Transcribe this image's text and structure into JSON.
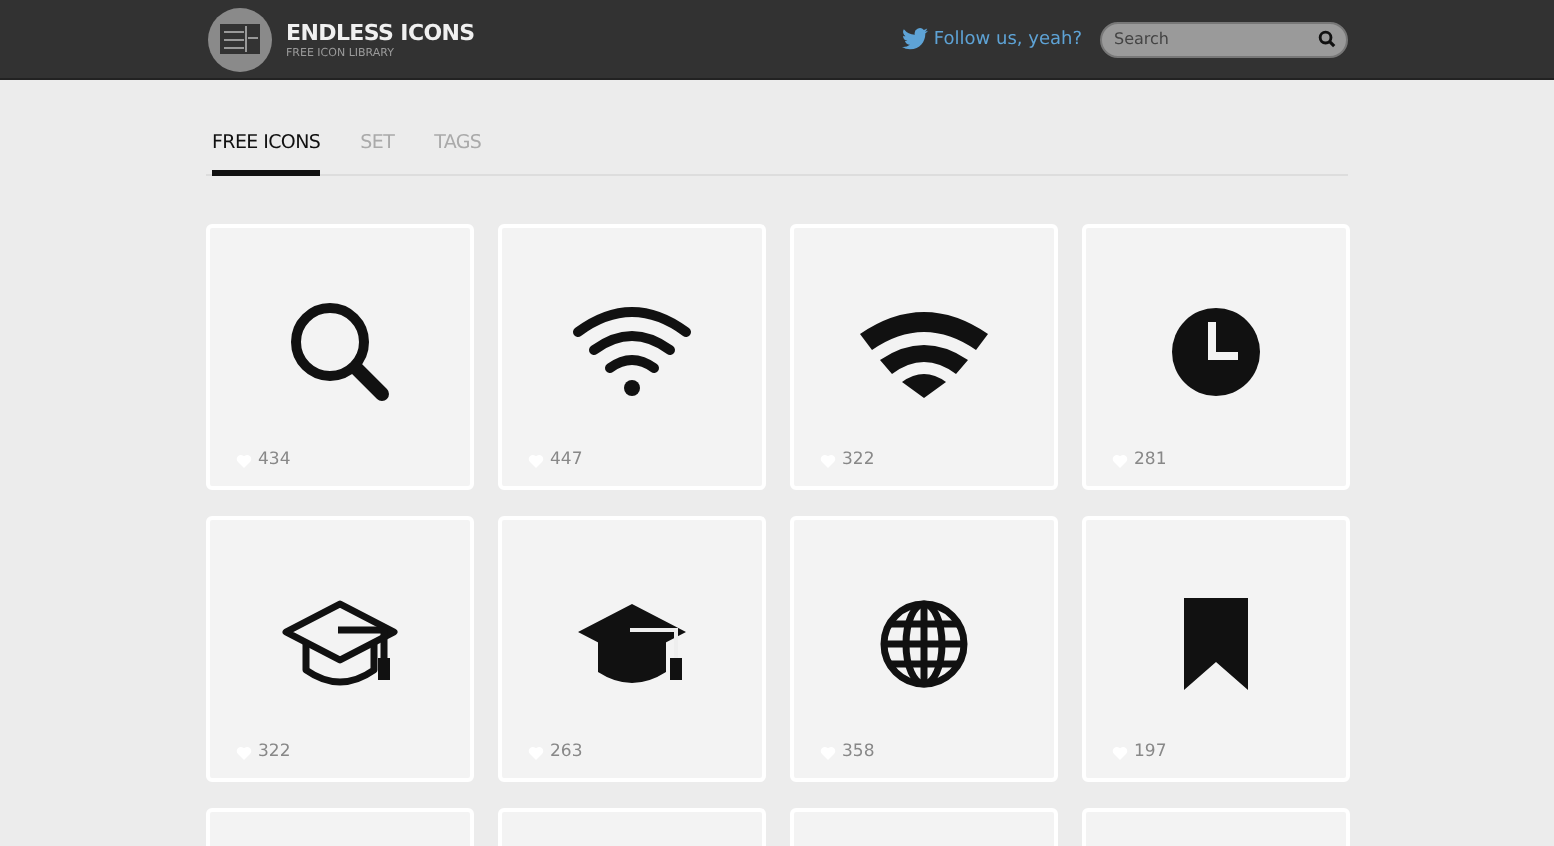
{
  "header": {
    "title": "ENDLESS ICONS",
    "subtitle": "FREE ICON LIBRARY",
    "follow": "Follow us, yeah?",
    "search": {
      "placeholder": "Search"
    }
  },
  "tabs": [
    {
      "label": "FREE ICONS",
      "selected": true
    },
    {
      "label": "SET",
      "selected": false
    },
    {
      "label": "TAGS",
      "selected": false
    }
  ],
  "icons": [
    {
      "kind": "search",
      "likes": "434"
    },
    {
      "kind": "wifi",
      "likes": "447"
    },
    {
      "kind": "wifi-fan",
      "likes": "322"
    },
    {
      "kind": "clock",
      "likes": "281"
    },
    {
      "kind": "cap-outline",
      "likes": "322"
    },
    {
      "kind": "cap",
      "likes": "263"
    },
    {
      "kind": "globe",
      "likes": "358"
    },
    {
      "kind": "bookmark",
      "likes": "197"
    },
    {
      "kind": "cut"
    },
    {
      "kind": "cut"
    },
    {
      "kind": "cut"
    },
    {
      "kind": "cut"
    }
  ]
}
